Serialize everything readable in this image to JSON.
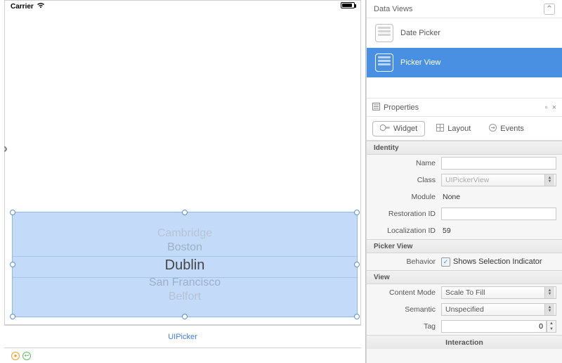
{
  "statusBar": {
    "carrier": "Carrier"
  },
  "picker": {
    "items": [
      "Cambridge",
      "Boston",
      "Dublin",
      "San Francisco",
      "Belfort"
    ],
    "caption": "UIPicker"
  },
  "dataViews": {
    "title": "Data Views",
    "items": [
      {
        "label": "Date Picker"
      },
      {
        "label": "Picker View"
      }
    ]
  },
  "properties": {
    "title": "Properties",
    "tabs": {
      "widget": "Widget",
      "layout": "Layout",
      "events": "Events"
    },
    "identity": {
      "heading": "Identity",
      "name_label": "Name",
      "name_value": "",
      "class_label": "Class",
      "class_value": "UIPickerView",
      "module_label": "Module",
      "module_value": "None",
      "restoration_label": "Restoration ID",
      "restoration_value": "",
      "localization_label": "Localization ID",
      "localization_value": "59"
    },
    "pickerView": {
      "heading": "Picker View",
      "behavior_label": "Behavior",
      "behavior_option": "Shows Selection Indicator"
    },
    "view": {
      "heading": "View",
      "content_mode_label": "Content Mode",
      "content_mode_value": "Scale To Fill",
      "semantic_label": "Semantic",
      "semantic_value": "Unspecified",
      "tag_label": "Tag",
      "tag_value": "0"
    },
    "interaction": {
      "heading": "Interaction"
    }
  }
}
